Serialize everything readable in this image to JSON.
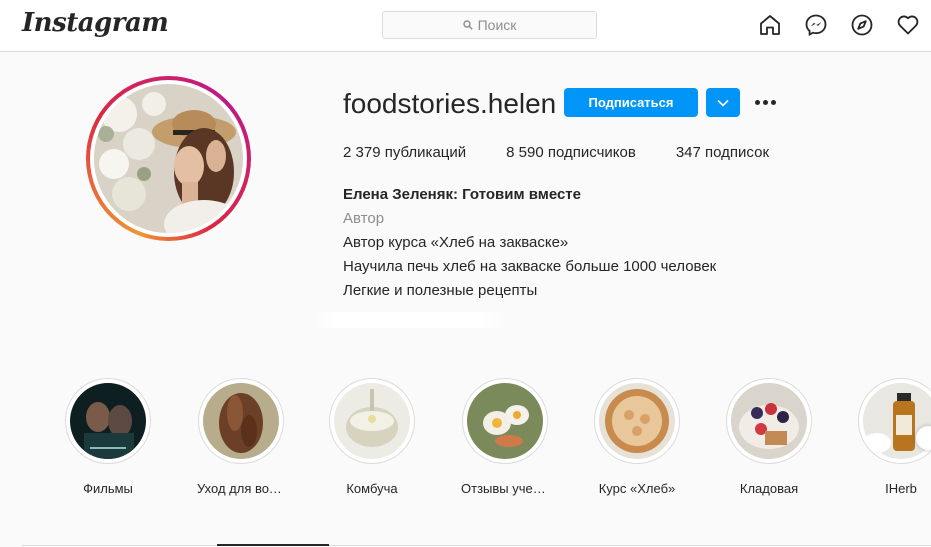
{
  "app": {
    "logo": "Instagram"
  },
  "search": {
    "placeholder": "Поиск"
  },
  "nav": {
    "icons": [
      "home-icon",
      "messenger-icon",
      "explore-icon",
      "heart-icon"
    ]
  },
  "profile": {
    "username": "foodstories.helen",
    "follow_label": "Подписаться",
    "stats": {
      "posts": "2 379",
      "posts_label": "публикаций",
      "followers": "8 590",
      "followers_label": "подписчиков",
      "following": "347",
      "following_label": "подписок"
    },
    "bio": {
      "name": "Елена Зеленяк: Готовим вместе",
      "category": "Автор",
      "lines": [
        "Автор курса «Хлеб на закваске»",
        "Научила печь хлеб на закваске больше 1000 человек",
        "Легкие и полезные рецепты"
      ]
    }
  },
  "highlights": [
    {
      "label": "Фильмы"
    },
    {
      "label": "Уход для волос"
    },
    {
      "label": "Комбуча"
    },
    {
      "label": "Отзывы учеников"
    },
    {
      "label": "Курс «Хлеб»"
    },
    {
      "label": "Кладовая"
    },
    {
      "label": "IHerb"
    }
  ],
  "colors": {
    "accent": "#0095f6",
    "text": "#262626",
    "muted": "#8e8e8e",
    "border": "#dbdbdb"
  }
}
